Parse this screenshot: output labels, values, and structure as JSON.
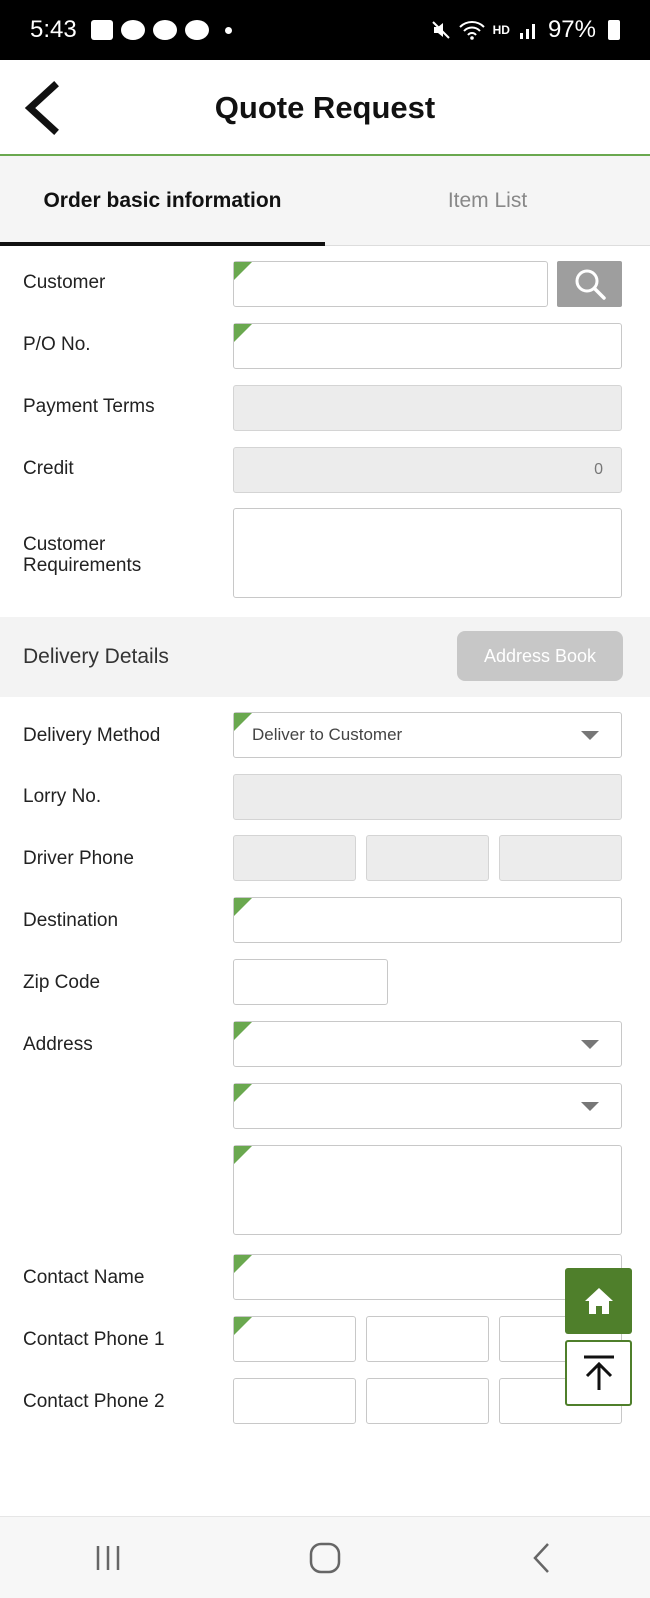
{
  "status_bar": {
    "time": "5:43",
    "battery": "97%"
  },
  "header": {
    "title": "Quote Request"
  },
  "tabs": [
    {
      "label": "Order basic information",
      "active": true
    },
    {
      "label": "Item List",
      "active": false
    }
  ],
  "form": {
    "customer_label": "Customer",
    "po_label": "P/O No.",
    "payment_terms_label": "Payment Terms",
    "credit_label": "Credit",
    "credit_value": "0",
    "customer_requirements_label_1": "Customer",
    "customer_requirements_label_2": "Requirements"
  },
  "delivery": {
    "section_title": "Delivery Details",
    "address_book_button": "Address Book",
    "delivery_method_label": "Delivery Method",
    "delivery_method_value": "Deliver to Customer",
    "lorry_label": "Lorry No.",
    "driver_phone_label": "Driver Phone",
    "destination_label": "Destination",
    "zip_label": "Zip Code",
    "address_label": "Address",
    "contact_name_label": "Contact Name",
    "contact_phone1_label": "Contact Phone 1",
    "contact_phone2_label": "Contact Phone 2"
  },
  "colors": {
    "accent_green": "#6aa84f",
    "fab_green": "#4f7f2b"
  },
  "icons": {
    "back": "chevron-left-icon",
    "search": "search-icon",
    "dropdown": "caret-down-icon",
    "home": "home-icon",
    "scroll_top": "arrow-up-to-top-icon",
    "nav_recent": "recent-apps-icon",
    "nav_home": "nav-home-icon",
    "nav_back": "nav-back-icon"
  }
}
